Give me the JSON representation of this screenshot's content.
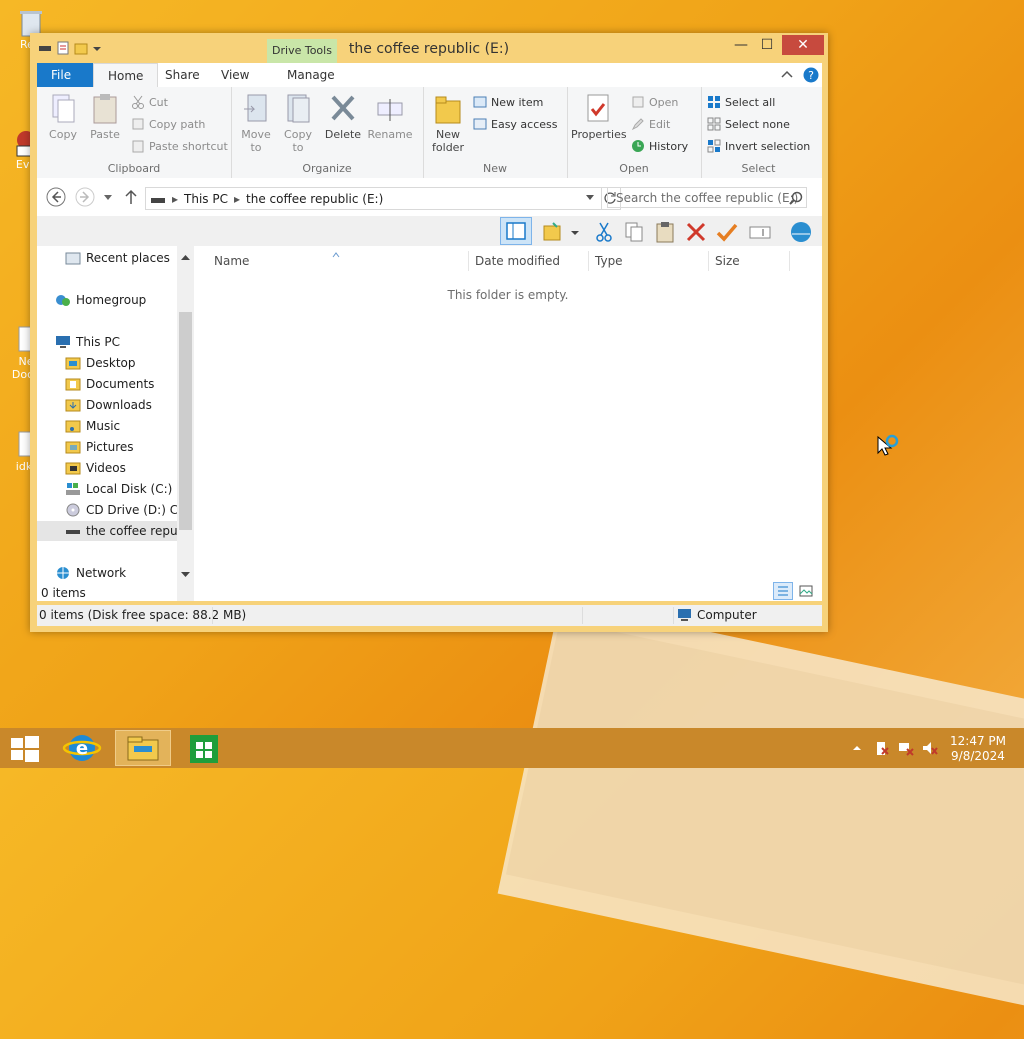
{
  "desktop": {
    "icons": [
      {
        "name": "Rec"
      },
      {
        "name": "Eve"
      },
      {
        "name": "Ne Docu"
      },
      {
        "name": "idk"
      }
    ]
  },
  "window": {
    "title": "the coffee republic (E:)",
    "context_tab": "Drive Tools",
    "controls": {
      "minimize": "—",
      "maximize": "☐",
      "close": "✕"
    }
  },
  "ribbon_tabs": [
    "File",
    "Home",
    "Share",
    "View",
    "Manage"
  ],
  "ribbon": {
    "clipboard": {
      "label": "Clipboard",
      "copy": "Copy",
      "paste": "Paste",
      "cut": "Cut",
      "copy_path": "Copy path",
      "paste_shortcut": "Paste shortcut"
    },
    "organize": {
      "label": "Organize",
      "move_to": "Move to",
      "copy_to": "Copy to",
      "delete": "Delete",
      "rename": "Rename"
    },
    "new": {
      "label": "New",
      "new_folder": "New folder",
      "new_item": "New item",
      "easy_access": "Easy access"
    },
    "open": {
      "label": "Open",
      "properties": "Properties",
      "open": "Open",
      "edit": "Edit",
      "history": "History"
    },
    "select": {
      "label": "Select",
      "select_all": "Select all",
      "select_none": "Select none",
      "invert": "Invert selection"
    }
  },
  "address": {
    "crumbs": [
      "This PC",
      "the coffee republic (E:)"
    ],
    "search_placeholder": "Search the coffee republic (E:)"
  },
  "nav_pane": {
    "items": [
      {
        "label": "Recent places"
      },
      {
        "label": "Homegroup"
      },
      {
        "label": "This PC"
      },
      {
        "label": "Desktop"
      },
      {
        "label": "Documents"
      },
      {
        "label": "Downloads"
      },
      {
        "label": "Music"
      },
      {
        "label": "Pictures"
      },
      {
        "label": "Videos"
      },
      {
        "label": "Local Disk (C:)"
      },
      {
        "label": "CD Drive (D:) CES"
      },
      {
        "label": "the coffee republ"
      },
      {
        "label": "Network"
      }
    ]
  },
  "columns": [
    "Name",
    "Date modified",
    "Type",
    "Size"
  ],
  "empty_message": "This folder is empty.",
  "item_count": "0 items",
  "status": {
    "left": "0 items (Disk free space: 88.2 MB)",
    "right": "Computer"
  },
  "clock": {
    "time": "12:47 PM",
    "date": "9/8/2024"
  },
  "colors": {
    "accent": "#1979ca",
    "close": "#c74a3e",
    "frame": "#f7d27a"
  }
}
